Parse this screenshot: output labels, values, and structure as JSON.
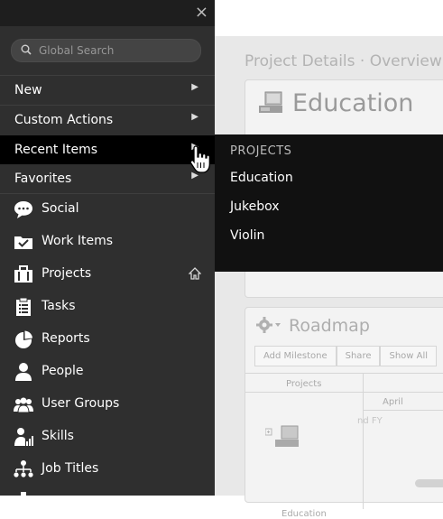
{
  "background": {
    "title": "Project Details · Overview V",
    "education_panel": {
      "title": "Education"
    },
    "roadmap": {
      "title": "Roadmap",
      "buttons": [
        "Add Milestone",
        "Share",
        "Show All"
      ],
      "columns": {
        "projects": "Projects",
        "april": "April"
      },
      "row_label": "Education",
      "fy_text": "nd FY"
    }
  },
  "menu": {
    "close_label": "×",
    "search": {
      "placeholder": "Global Search"
    },
    "items": [
      {
        "label": "New"
      },
      {
        "label": "Custom Actions"
      },
      {
        "label": "Recent Items"
      },
      {
        "label": "Favorites"
      }
    ],
    "nav": [
      {
        "label": "Social",
        "icon": "speech-bubble-icon"
      },
      {
        "label": "Work Items",
        "icon": "folder-check-icon"
      },
      {
        "label": "Projects",
        "icon": "briefcase-icon"
      },
      {
        "label": "Tasks",
        "icon": "clipboard-icon"
      },
      {
        "label": "Reports",
        "icon": "pie-chart-icon"
      },
      {
        "label": "People",
        "icon": "person-icon"
      },
      {
        "label": "User Groups",
        "icon": "group-icon"
      },
      {
        "label": "Skills",
        "icon": "skills-icon"
      },
      {
        "label": "Job Titles",
        "icon": "org-chart-icon"
      }
    ]
  },
  "submenu": {
    "heading": "PROJECTS",
    "items": [
      "Education",
      "Jukebox",
      "Violin"
    ]
  },
  "colors": {
    "menu_bg": "#2f2f2f",
    "active_bg": "#000000",
    "submenu_bg": "#111111"
  }
}
